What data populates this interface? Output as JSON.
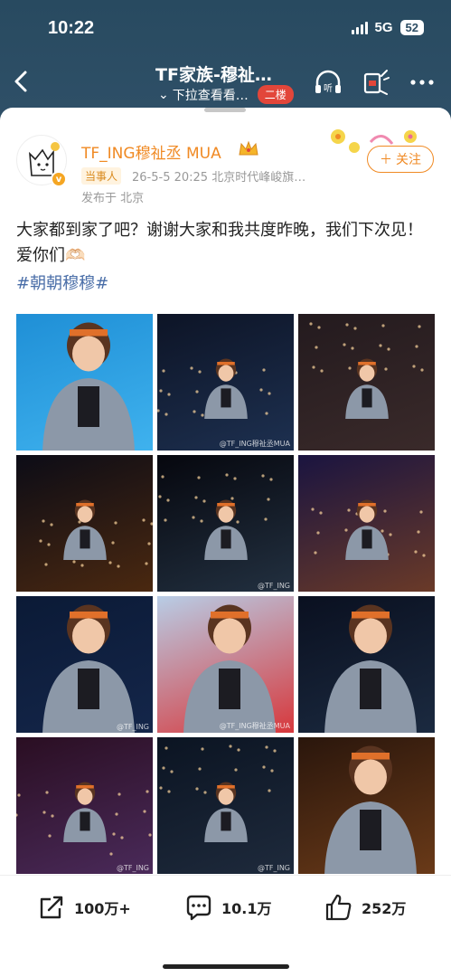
{
  "status": {
    "time": "10:22",
    "network": "5G",
    "battery": "52"
  },
  "nav": {
    "title": "TF家族-穆祉…",
    "subtitle": "下拉查看看…",
    "floor_badge": "二楼",
    "listen_label": "听"
  },
  "post": {
    "username": "TF_ING穆祉丞 MUA",
    "tag": "当事人",
    "meta": "26-5-5 20:25  北京时代峰峻旗…",
    "location": "发布于 北京",
    "follow_label": "关注",
    "text": "大家都到家了吧？谢谢大家和我共度昨晚，我们下次见！爱你们🫶🏻",
    "hashtag": "#朝朝穆穆#"
  },
  "photos": [
    {
      "bg": "#1f8fd6",
      "bg2": "#3fb2ee",
      "watermark": ""
    },
    {
      "bg": "#0d1426",
      "bg2": "#1d3050",
      "watermark": "@TF_ING穆祉丞MUA"
    },
    {
      "bg": "#231a1e",
      "bg2": "#3a2a2a",
      "watermark": ""
    },
    {
      "bg": "#0c0c16",
      "bg2": "#4a2810",
      "watermark": ""
    },
    {
      "bg": "#06070e",
      "bg2": "#223040",
      "watermark": "@TF_ING"
    },
    {
      "bg": "#1a1440",
      "bg2": "#6a3a28",
      "watermark": ""
    },
    {
      "bg": "#0b1a36",
      "bg2": "#14264a",
      "watermark": "@TF_ING"
    },
    {
      "bg": "#b8cde6",
      "bg2": "#d7383c",
      "watermark": "@TF_ING穆祉丞MUA"
    },
    {
      "bg": "#0a1020",
      "bg2": "#1b2a40",
      "watermark": ""
    },
    {
      "bg": "#2a0e22",
      "bg2": "#4a2a5a",
      "watermark": "@TF_ING"
    },
    {
      "bg": "#0b1422",
      "bg2": "#1e2a3c",
      "watermark": "@TF_ING"
    },
    {
      "bg": "#2a160c",
      "bg2": "#6a3a18",
      "watermark": ""
    }
  ],
  "actions": {
    "share_count": "100万+",
    "comment_count": "10.1万",
    "like_count": "252万"
  },
  "colors": {
    "accent": "#f08a24",
    "link": "#4a6ea8",
    "header": "#2d4d63"
  }
}
